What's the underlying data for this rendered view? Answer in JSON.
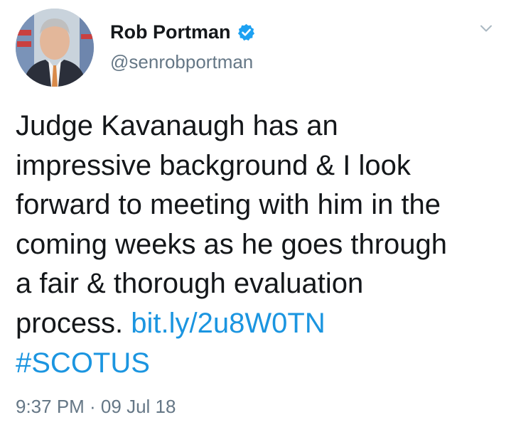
{
  "user": {
    "display_name": "Rob Portman",
    "handle": "@senrobportman",
    "verified": true
  },
  "tweet": {
    "lines": [
      "Judge Kavanaugh has an",
      "impressive background & I look",
      "forward to meeting with him in the",
      "coming weeks as he goes through",
      "a fair & thorough evaluation"
    ],
    "last_line_text": "process. ",
    "link_text": "bit.ly/2u8W0TN",
    "hashtag": "#SCOTUS"
  },
  "meta": {
    "timestamp": "9:37 PM · 09 Jul 18"
  },
  "icons": {
    "verified": "verified-badge-icon",
    "menu": "chevron-down-icon",
    "avatar": "profile-photo"
  },
  "colors": {
    "link": "#1b95e0",
    "verified": "#1da1f2",
    "secondary_text": "#657786",
    "primary_text": "#14171a"
  }
}
